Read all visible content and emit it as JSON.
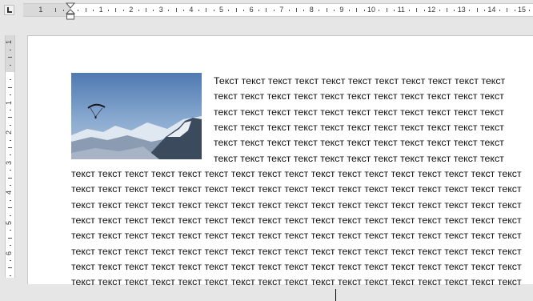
{
  "ruler": {
    "horizontal_numbers": [
      "1",
      "1",
      "2",
      "3",
      "4",
      "5",
      "6",
      "7",
      "8",
      "9",
      "10",
      "11",
      "12",
      "13",
      "14",
      "15"
    ],
    "vertical_numbers": [
      "1",
      "1",
      "2",
      "3",
      "4",
      "5",
      "6"
    ]
  },
  "document": {
    "image": {
      "description_icon": "paraglider-mountains-image"
    },
    "wrapped_lines": [
      "Текст текст текст текст текст текст текст текст текст текст текст",
      "текст текст текст текст текст текст текст текст текст текст текст",
      "текст текст текст текст текст текст текст текст текст текст текст",
      "текст текст текст текст текст текст текст текст текст текст текст",
      "текст текст текст текст текст текст текст текст текст текст текст",
      "текст текст текст текст текст текст текст текст текст текст текст"
    ],
    "full_lines": [
      "текст текст текст текст текст текст текст текст текст текст текст текст текст текст текст текст текст",
      "текст текст текст текст текст текст текст текст текст текст текст текст текст текст текст текст текст",
      "текст текст текст текст текст текст текст текст текст текст текст текст текст текст текст текст текст",
      "текст текст текст текст текст текст текст текст текст текст текст текст текст текст текст текст текст",
      "текст текст текст текст текст текст текст текст текст текст текст текст текст текст текст текст текст",
      "текст текст текст текст текст текст текст текст текст текст текст текст текст текст текст текст текст",
      "текст текст текст текст текст текст текст текст текст текст текст текст текст текст текст текст текст",
      "текст текст текст текст текст текст текст текст текст текст текст текст текст текст текст текст текст"
    ]
  },
  "colors": {
    "page": "#ffffff",
    "workspace": "#e6e6e6",
    "ruler_margin": "#d9d9d9"
  }
}
